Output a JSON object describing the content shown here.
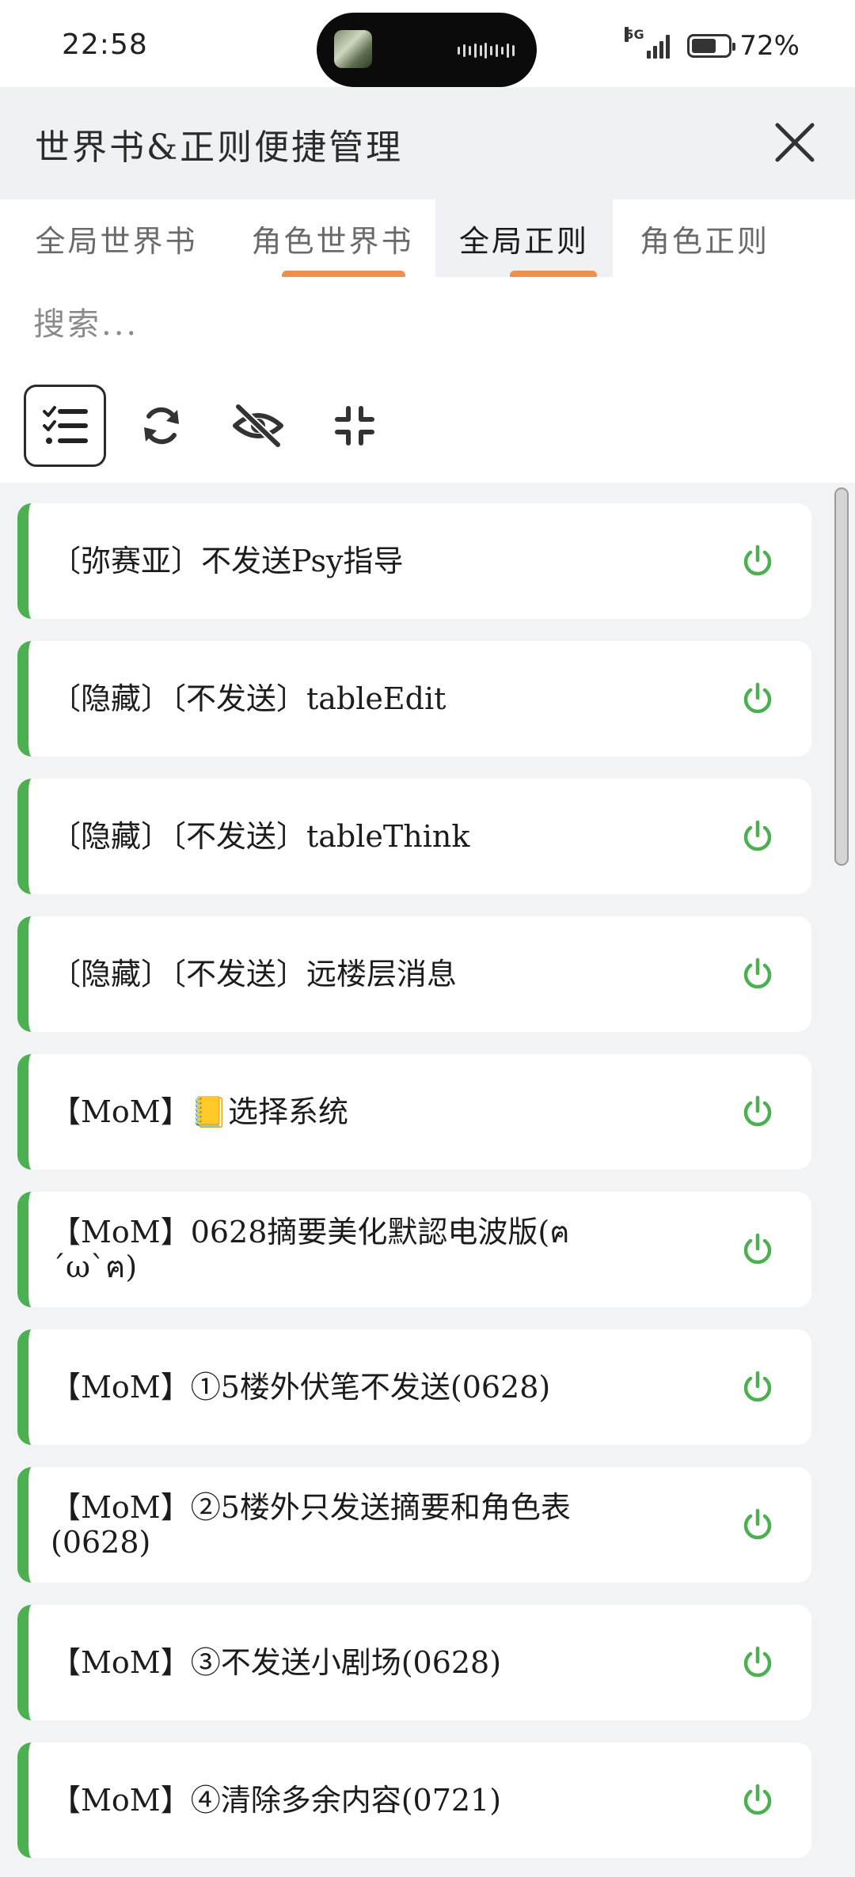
{
  "status_bar": {
    "time": "22:58",
    "network": "5G",
    "battery_percent": 72,
    "battery_text": "72%"
  },
  "header": {
    "title": "世界书&正则便捷管理",
    "close_icon": "close-icon"
  },
  "tabs": [
    {
      "label": "全局世界书",
      "active": false,
      "underlined": true
    },
    {
      "label": "角色世界书",
      "active": false,
      "underlined": true
    },
    {
      "label": "全局正则",
      "active": true,
      "underlined": true
    },
    {
      "label": "角色正则",
      "active": false,
      "underlined": true
    }
  ],
  "search": {
    "placeholder": "搜索...",
    "value": ""
  },
  "toolbar": [
    {
      "icon": "list-check-icon",
      "active": true
    },
    {
      "icon": "refresh-icon",
      "active": false
    },
    {
      "icon": "eye-off-icon",
      "active": false
    },
    {
      "icon": "collapse-icon",
      "active": false
    }
  ],
  "colors": {
    "accent_green": "#4caf50",
    "underline_orange": "#f08f4c"
  },
  "items": [
    {
      "label": "〔弥赛亚〕不发送Psy指导",
      "enabled": true
    },
    {
      "label": "〔隐藏〕〔不发送〕tableEdit",
      "enabled": true
    },
    {
      "label": "〔隐藏〕〔不发送〕tableThink",
      "enabled": true
    },
    {
      "label": "〔隐藏〕〔不发送〕远楼层消息",
      "enabled": true
    },
    {
      "label": "【MoM】📒选择系统",
      "enabled": true
    },
    {
      "label": "【MoM】0628摘要美化默認电波版(ฅ´ω`ฅ)",
      "enabled": true
    },
    {
      "label": "【MoM】①5楼外伏笔不发送(0628)",
      "enabled": true
    },
    {
      "label": "【MoM】②5楼外只发送摘要和角色表(0628)",
      "enabled": true
    },
    {
      "label": "【MoM】③不发送小剧场(0628)",
      "enabled": true
    },
    {
      "label": "【MoM】④清除多余内容(0721)",
      "enabled": true
    }
  ]
}
